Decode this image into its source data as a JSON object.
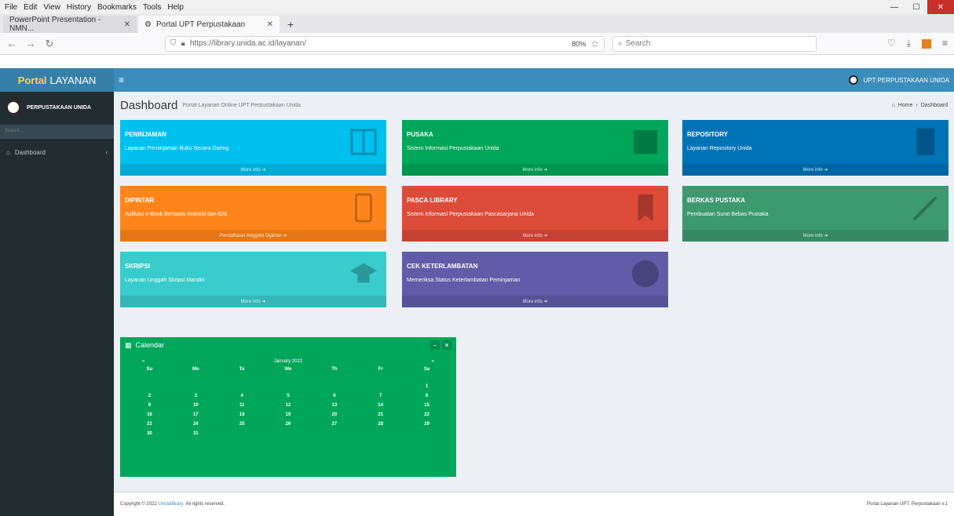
{
  "menubar": {
    "items": [
      "File",
      "Edit",
      "View",
      "History",
      "Bookmarks",
      "Tools",
      "Help"
    ]
  },
  "tabs": [
    {
      "label": "PowerPoint Presentation - NMN..."
    },
    {
      "label": "Portal UPT Perpustakaan"
    }
  ],
  "navbar": {
    "url": "https://library.unida.ac.id/layanan/",
    "zoom": "80%",
    "search_placeholder": "Search"
  },
  "app": {
    "logo_bold": "Portal",
    "logo_rest": "LAYANAN",
    "user_label": "UPT PERPUSTAKAAN UNIDA",
    "sidebar": {
      "user_name": "PERPUSTAKAAN UNIDA",
      "search_placeholder": "Search...",
      "menu": [
        {
          "label": "Dashboard"
        }
      ]
    },
    "page_title": "Dashboard",
    "page_subtitle": "Portal Layanan Online UPT Perpustakaan Unida",
    "breadcrumb": {
      "home": "Home",
      "current": "Dashboard"
    },
    "boxes": [
      {
        "title": "PENINJAMAN",
        "subtitle": "Layanan Peminjaman Buku Secara Daring",
        "footer": "More info",
        "color": "#00c0ef"
      },
      {
        "title": "PUSAKA",
        "subtitle": "Sistem Informasi Perpustakaan Unida",
        "footer": "More info",
        "color": "#00a65a"
      },
      {
        "title": "REPOSITORY",
        "subtitle": "Layanan Repository Unida",
        "footer": "More info",
        "color": "#0073b7"
      },
      {
        "title": "DIPINTAR",
        "subtitle": "Aplikasi e-Book Berbasis Android dan iOS",
        "footer": "Pendaftaran Anggota Dipintar",
        "color": "#ff851b"
      },
      {
        "title": "PASCA LIBRARY",
        "subtitle": "Sistem Informasi Perpustakaan Pascasarjana Unida",
        "footer": "More info",
        "color": "#dd4b39"
      },
      {
        "title": "BERKAS PUSTAKA",
        "subtitle": "Pembuatan Surat Bebas Pustaka",
        "footer": "More info",
        "color": "#3d9970"
      },
      {
        "title": "SKRIPSI",
        "subtitle": "Layanan Unggah Skripsi Mandiri",
        "footer": "More info",
        "color": "#39cccc"
      },
      {
        "title": "CEK KETERLAMBATAN",
        "subtitle": "Memeriksa Status Keterlambatan Peminjaman",
        "footer": "More info",
        "color": "#605ca8"
      }
    ],
    "calendar": {
      "title": "Calendar",
      "month": "January 2022",
      "prev": "«",
      "next": "»",
      "weekdays": [
        "Su",
        "Mo",
        "Tu",
        "We",
        "Th",
        "Fr",
        "Sa"
      ],
      "weeks": [
        [
          "",
          "",
          "",
          "",
          "",
          "",
          "1"
        ],
        [
          "2",
          "3",
          "4",
          "5",
          "6",
          "7",
          "8"
        ],
        [
          "9",
          "10",
          "11",
          "12",
          "13",
          "14",
          "15"
        ],
        [
          "16",
          "17",
          "18",
          "19",
          "20",
          "21",
          "22"
        ],
        [
          "23",
          "24",
          "25",
          "26",
          "27",
          "28",
          "29"
        ],
        [
          "30",
          "31",
          "",
          "",
          "",
          "",
          ""
        ]
      ]
    },
    "footer": {
      "copyright": "Copyright © 2022",
      "link": "Unidalibrary.",
      "rights": "All rights reserved.",
      "right": "Portal Layanan UPT. Perpustakaan v.1"
    }
  }
}
